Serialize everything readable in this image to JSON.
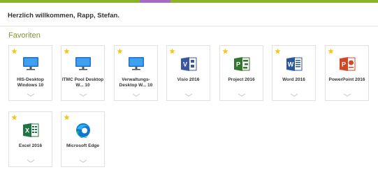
{
  "header": {
    "welcome": "Herzlich willkommen, Rapp, Stefan."
  },
  "section": {
    "title": "Favoriten"
  },
  "colors": {
    "brand_green": "#8ab32a",
    "brand_purple": "#a66cc4",
    "star": "#f5c518"
  },
  "tiles": [
    {
      "line1": "HIS-Desktop",
      "line2": "Windows 10",
      "icon": "monitor-icon",
      "favorite": true
    },
    {
      "line1": "ITMC Pool Desktop",
      "line2": "W... 10",
      "icon": "monitor-icon",
      "favorite": true
    },
    {
      "line1": "Verwaltungs-",
      "line2": "Desktop W... 10",
      "icon": "monitor-icon",
      "favorite": true
    },
    {
      "line1": "Visio 2016",
      "line2": "",
      "icon": "visio-icon",
      "favorite": true
    },
    {
      "line1": "Project 2016",
      "line2": "",
      "icon": "project-icon",
      "favorite": true
    },
    {
      "line1": "Word 2016",
      "line2": "",
      "icon": "word-icon",
      "favorite": true
    },
    {
      "line1": "PowerPoint 2016",
      "line2": "",
      "icon": "powerpoint-icon",
      "favorite": true
    },
    {
      "line1": "Excel 2016",
      "line2": "",
      "icon": "excel-icon",
      "favorite": true
    },
    {
      "line1": "Microsoft Edge",
      "line2": "",
      "icon": "edge-icon",
      "favorite": true
    }
  ]
}
